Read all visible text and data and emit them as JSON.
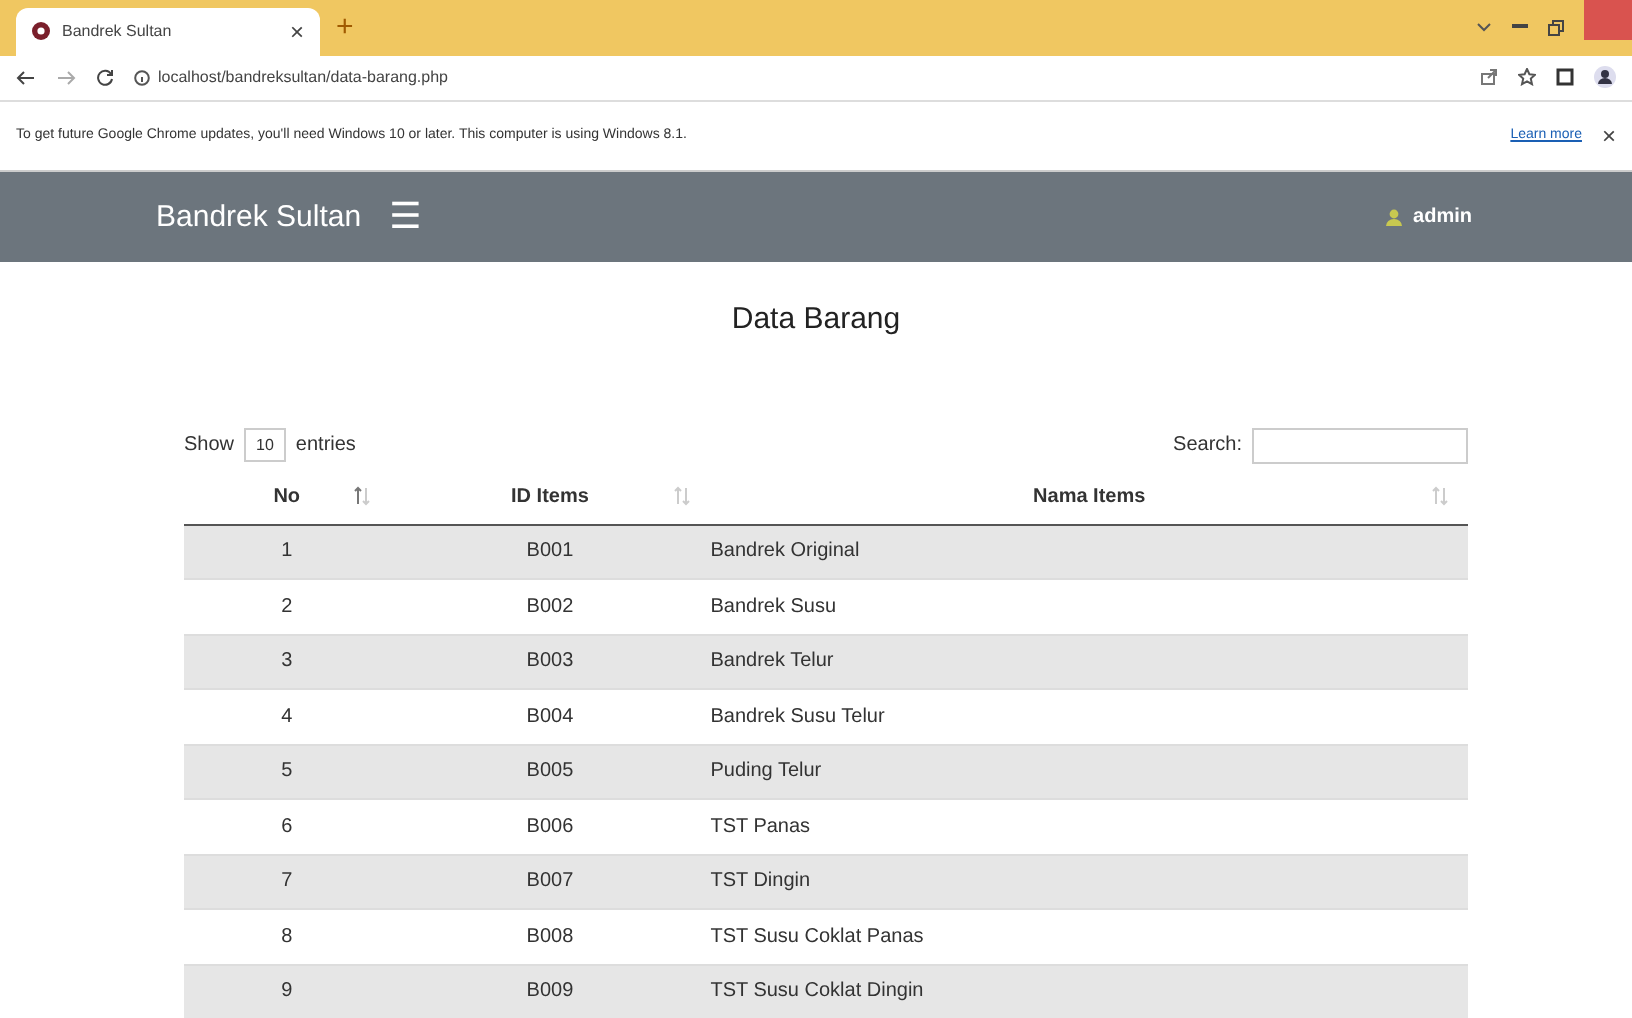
{
  "browser": {
    "tab": {
      "title": "Bandrek Sultan",
      "close": "×",
      "new_tab": "+"
    },
    "address": "localhost/bandreksultan/data-barang.php"
  },
  "info_bar": {
    "message": "To get future Google Chrome updates, you'll need Windows 10 or later. This computer is using Windows 8.1.",
    "link": "Learn more",
    "close": "×"
  },
  "navbar": {
    "brand": "Bandrek Sultan",
    "menu": "☰",
    "user": "admin"
  },
  "page_title": "Data Barang",
  "length": {
    "before": "Show",
    "value": "10",
    "after": "entries"
  },
  "search": {
    "label": "Search:"
  },
  "table": {
    "columns": [
      {
        "label": "No",
        "sorted": true
      },
      {
        "label": "ID Items",
        "sorted": false
      },
      {
        "label": "Nama Items",
        "sorted": false
      }
    ],
    "rows": [
      [
        "1",
        "B001",
        "Bandrek Original"
      ],
      [
        "2",
        "B002",
        "Bandrek Susu"
      ],
      [
        "3",
        "B003",
        "Bandrek Telur"
      ],
      [
        "4",
        "B004",
        "Bandrek Susu Telur"
      ],
      [
        "5",
        "B005",
        "Puding Telur"
      ],
      [
        "6",
        "B006",
        "TST Panas"
      ],
      [
        "7",
        "B007",
        "TST Dingin"
      ],
      [
        "8",
        "B008",
        "TST Susu Coklat Panas"
      ],
      [
        "9",
        "B009",
        "TST Susu Coklat Dingin"
      ]
    ]
  }
}
